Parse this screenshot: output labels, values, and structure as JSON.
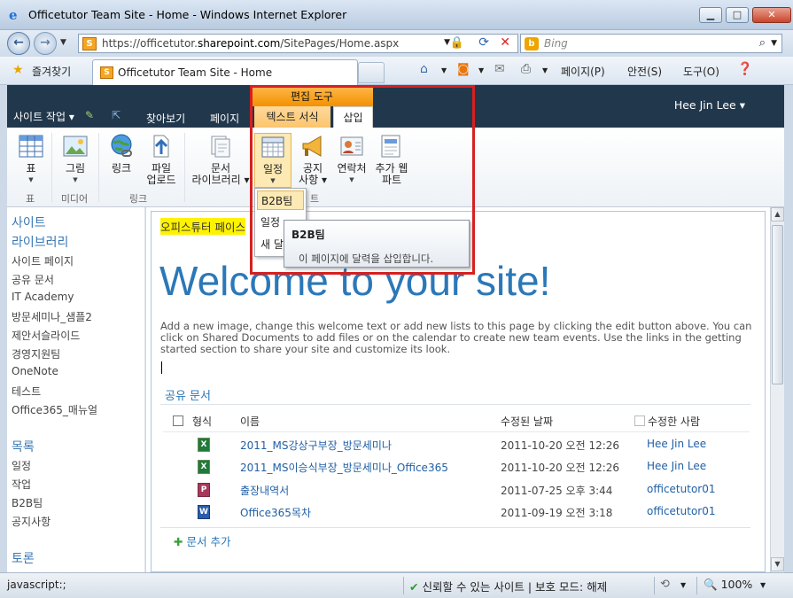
{
  "window": {
    "title": "Officetutor Team Site - Home - Windows Internet Explorer",
    "minimize": "▁",
    "maximize": "□",
    "close": "✕"
  },
  "address": {
    "url_prefix": "https://officetutor.",
    "url_host": "sharepoint.com",
    "url_path": "/SitePages/Home.aspx",
    "search_placeholder": "Bing"
  },
  "favorites": {
    "label": "즐겨찾기",
    "tab_title": "Officetutor Team Site - Home"
  },
  "commandbar": {
    "page": "페이지(P)",
    "safety": "안전(S)",
    "tools": "도구(O)"
  },
  "sharepoint": {
    "site_actions": "사이트 작업",
    "browse": "찾아보기",
    "page": "페이지",
    "user": "Hee Jin Lee",
    "context_group": "편집 도구",
    "tab_text_format": "텍스트 서식",
    "tab_insert": "삽입"
  },
  "ribbon": {
    "table": "표",
    "picture": "그림",
    "link": "링크",
    "upload_1": "파일",
    "upload_2": "업로드",
    "doclib_1": "문서",
    "doclib_2": "라이브러리",
    "calendar": "일정",
    "announce_1": "공지",
    "announce_2": "사항",
    "contacts": "연락처",
    "webpart_1": "추가 웹",
    "webpart_2": "파트",
    "group_table": "표",
    "group_media": "미디어",
    "group_links": "링크",
    "group_webparts_partial": "트"
  },
  "dropdown": {
    "items": [
      "B2B팀",
      "일정",
      "새 달력"
    ]
  },
  "tooltip": {
    "title": "B2B팀",
    "description": "이 페이지에 달력을 삽입합니다."
  },
  "leftnav": {
    "heading1_line1": "사이트",
    "heading1_line2": "라이브러리",
    "libraries": [
      "사이트 페이지",
      "공유 문서",
      "IT Academy",
      "방문세미나_샘플2",
      "제안서슬라이드",
      "경영지원팀",
      "OneNote",
      "테스트",
      "Office365_매뉴얼"
    ],
    "heading2": "목록",
    "lists": [
      "일정",
      "작업",
      "B2B팀",
      "공지사항"
    ],
    "heading3": "토론"
  },
  "main": {
    "highlight_title": "오피스튜터 페이스",
    "welcome": "Welcome to your site!",
    "intro": "Add a new image, change this welcome text or add new lists to this page by clicking the edit button above. You can click on Shared Documents to add files or on the calendar to create new team events. Use the links in the getting started section to share your site and customize its look.",
    "library_title": "공유 문서",
    "columns": {
      "type": "형식",
      "name": "이름",
      "modified": "수정된 날짜",
      "modified_by": "수정한 사람"
    },
    "documents": [
      {
        "icon": "excel-icon",
        "icon_color": "#1f7a3a",
        "name": "2011_MS강상구부장_방문세미나",
        "date": "2011-10-20 오전 12:26",
        "user": "Hee Jin Lee"
      },
      {
        "icon": "excel-icon",
        "icon_color": "#1f7a3a",
        "name": "2011_MS이승식부장_방문세미나_Office365",
        "date": "2011-10-20 오전 12:26",
        "user": "Hee Jin Lee"
      },
      {
        "icon": "powerpoint-icon",
        "icon_color": "#a6395b",
        "name": "출장내역서",
        "date": "2011-07-25 오후 3:44",
        "user": "officetutor01"
      },
      {
        "icon": "word-icon",
        "icon_color": "#2a5daa",
        "name": "Office365목차",
        "date": "2011-09-19 오전 3:18",
        "user": "officetutor01"
      }
    ],
    "add_document": "문서 추가"
  },
  "status": {
    "left": "javascript:;",
    "zone": "신뢰할 수 있는 사이트 | 보호 모드: 해제",
    "zoom": "100%"
  },
  "colors": {
    "accent": "#2b78b8",
    "context_tab": "#f29200",
    "highlight_box": "#d62020",
    "header": "#21374c"
  }
}
